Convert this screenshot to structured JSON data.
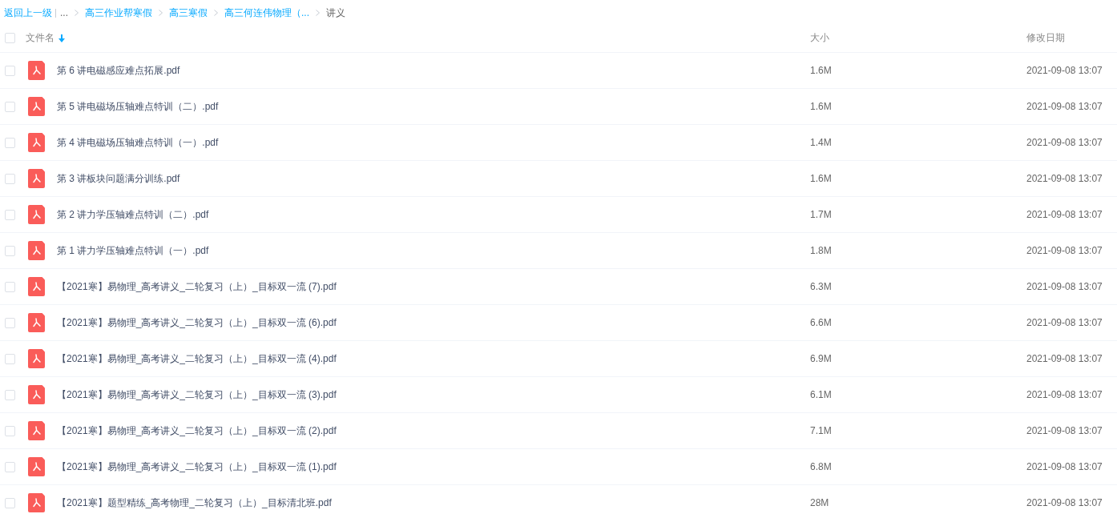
{
  "breadcrumb": {
    "back": "返回上一级",
    "items": [
      {
        "label": "...",
        "kind": "ellipsis"
      },
      {
        "label": "高三作业帮寒假",
        "kind": "link"
      },
      {
        "label": "高三寒假",
        "kind": "link"
      },
      {
        "label": "高三何连伟物理（...",
        "kind": "link"
      },
      {
        "label": "讲义",
        "kind": "current"
      }
    ]
  },
  "table": {
    "select_all": {
      "checked": false
    },
    "columns": [
      {
        "label": "文件名",
        "sorted": true
      },
      {
        "label": "大小",
        "sorted": false
      },
      {
        "label": "修改日期",
        "sorted": false
      }
    ],
    "rows": [
      {
        "name": "第 6 讲电磁感应难点拓展.pdf",
        "size": "1.6M",
        "modified": "2021-09-08 13:07",
        "checked": false
      },
      {
        "name": "第 5 讲电磁场压轴难点特训（二）.pdf",
        "size": "1.6M",
        "modified": "2021-09-08 13:07",
        "checked": false
      },
      {
        "name": "第 4 讲电磁场压轴难点特训（一）.pdf",
        "size": "1.4M",
        "modified": "2021-09-08 13:07",
        "checked": false
      },
      {
        "name": "第 3 讲板块问题满分训练.pdf",
        "size": "1.6M",
        "modified": "2021-09-08 13:07",
        "checked": false
      },
      {
        "name": "第 2 讲力学压轴难点特训（二）.pdf",
        "size": "1.7M",
        "modified": "2021-09-08 13:07",
        "checked": false
      },
      {
        "name": "第 1 讲力学压轴难点特训（一）.pdf",
        "size": "1.8M",
        "modified": "2021-09-08 13:07",
        "checked": false
      },
      {
        "name": "【2021寒】易物理_高考讲义_二轮复习（上）_目标双一流 (7).pdf",
        "size": "6.3M",
        "modified": "2021-09-08 13:07",
        "checked": false
      },
      {
        "name": "【2021寒】易物理_高考讲义_二轮复习（上）_目标双一流 (6).pdf",
        "size": "6.6M",
        "modified": "2021-09-08 13:07",
        "checked": false
      },
      {
        "name": "【2021寒】易物理_高考讲义_二轮复习（上）_目标双一流 (4).pdf",
        "size": "6.9M",
        "modified": "2021-09-08 13:07",
        "checked": false
      },
      {
        "name": "【2021寒】易物理_高考讲义_二轮复习（上）_目标双一流 (3).pdf",
        "size": "6.1M",
        "modified": "2021-09-08 13:07",
        "checked": false
      },
      {
        "name": "【2021寒】易物理_高考讲义_二轮复习（上）_目标双一流 (2).pdf",
        "size": "7.1M",
        "modified": "2021-09-08 13:07",
        "checked": false
      },
      {
        "name": "【2021寒】易物理_高考讲义_二轮复习（上）_目标双一流 (1).pdf",
        "size": "6.8M",
        "modified": "2021-09-08 13:07",
        "checked": false
      },
      {
        "name": "【2021寒】题型精练_高考物理_二轮复习（上）_目标清北班.pdf",
        "size": "28M",
        "modified": "2021-09-08 13:07",
        "checked": false
      }
    ]
  }
}
